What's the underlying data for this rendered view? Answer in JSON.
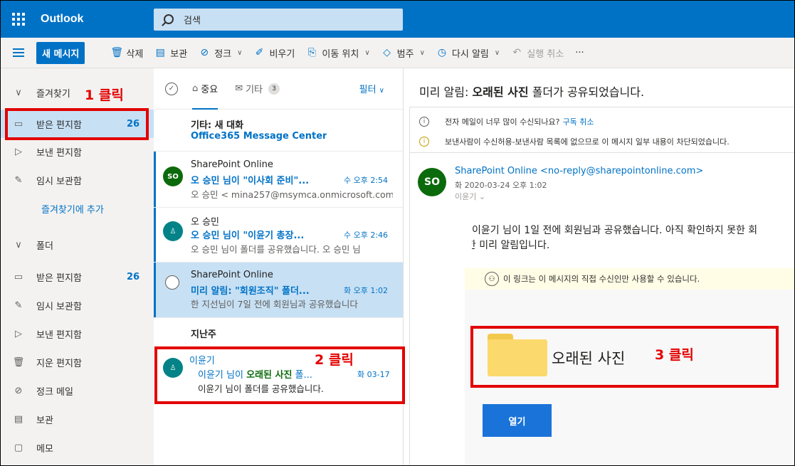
{
  "app": {
    "name": "Outlook"
  },
  "search": {
    "placeholder": "검색"
  },
  "toolbar": {
    "new_mail": "새 메시지",
    "delete": "삭제",
    "archive": "보관",
    "junk": "정크",
    "sweep": "비우기",
    "move": "이동 위치",
    "categorize": "범주",
    "snooze": "다시 알림",
    "undo": "실행 취소",
    "more": "···"
  },
  "nav": {
    "favorites": "즐겨찾기",
    "fav_inbox": "받은 편지함",
    "fav_inbox_count": "26",
    "fav_sent": "보낸 편지함",
    "fav_drafts": "임시 보관함",
    "add_favorite": "즐겨찾기에 추가",
    "folders": "폴더",
    "inbox": "받은 편지함",
    "inbox_count": "26",
    "drafts": "임시 보관함",
    "sent": "보낸 편지함",
    "deleted": "지운 편지함",
    "junk": "정크 메일",
    "archive": "보관",
    "notes": "메모"
  },
  "list": {
    "tab_focused": "중요",
    "tab_other": "기타",
    "other_count": "3",
    "filter": "필터",
    "section_last_week": "지난주",
    "messages": [
      {
        "from": "기타: 새 대화",
        "subject": "Office365 Message Center"
      },
      {
        "avatar": "SO",
        "from": "SharePoint Online",
        "subject": "오 승민 님이 \"이사회 준비\"...",
        "time": "수 오후 2:54",
        "preview": "오 승민 < mina257@msymca.onmicrosoft.com"
      },
      {
        "from": "오 승민",
        "subject": "오 승민 님이 \"이윤기 총장...",
        "time": "수 오후 2:46",
        "preview": "오 승민 님이 폴더를 공유했습니다. 오 승민 님"
      },
      {
        "from": "SharePoint Online",
        "subject": "미리 알림: \"회원조직\" 폴더...",
        "time": "화 오후 1:02",
        "preview": "한 지선님이 7일 전에 회원님과 공유했습니다"
      },
      {
        "from": "이윤기",
        "subject_prefix": "이윤기 님이 ",
        "subject_highlight": "오래된 사진",
        "subject_suffix": " 폴...",
        "time": "화 03-17",
        "preview_name": "이윤기",
        "preview_rest": " 님이 폴더를 공유했습니다."
      }
    ]
  },
  "reading": {
    "title_prefix": "미리 알림: ",
    "title_bold": "오래된 사진",
    "title_suffix": " 폴더가 공유되었습니다.",
    "info1": "전자 메일이 너무 많이 수신되나요?",
    "info1_link": "구독 취소",
    "info2": "보낸사람이 수신허용-보낸사람 목록에 없으므로 이 메시지 일부 내용이 차단되었습니다.",
    "sender_avatar": "SO",
    "sender": "SharePoint Online <no-reply@sharepointonline.com>",
    "date": "화 2020-03-24 오후 1:02",
    "to": "이윤기",
    "body_line1": "이윤기 님이 1일 전에 회원님과 공유했습니다. 아직 확인하지 못한 회",
    "body_line2": "단한 미리 알림입니다.",
    "notice": "이 링크는 이 메시지의 직접 수신인만 사용할 수 있습니다.",
    "folder_name": "오래된 사진",
    "open_button": "열기"
  },
  "annotations": {
    "step1": "1 클릭",
    "step2": "2 클릭",
    "step3": "3 클릭",
    "color": "#e30000"
  },
  "colors": {
    "brand": "#0072c6",
    "selected": "#c7e0f4",
    "nav_bg": "#f3f2f1"
  }
}
